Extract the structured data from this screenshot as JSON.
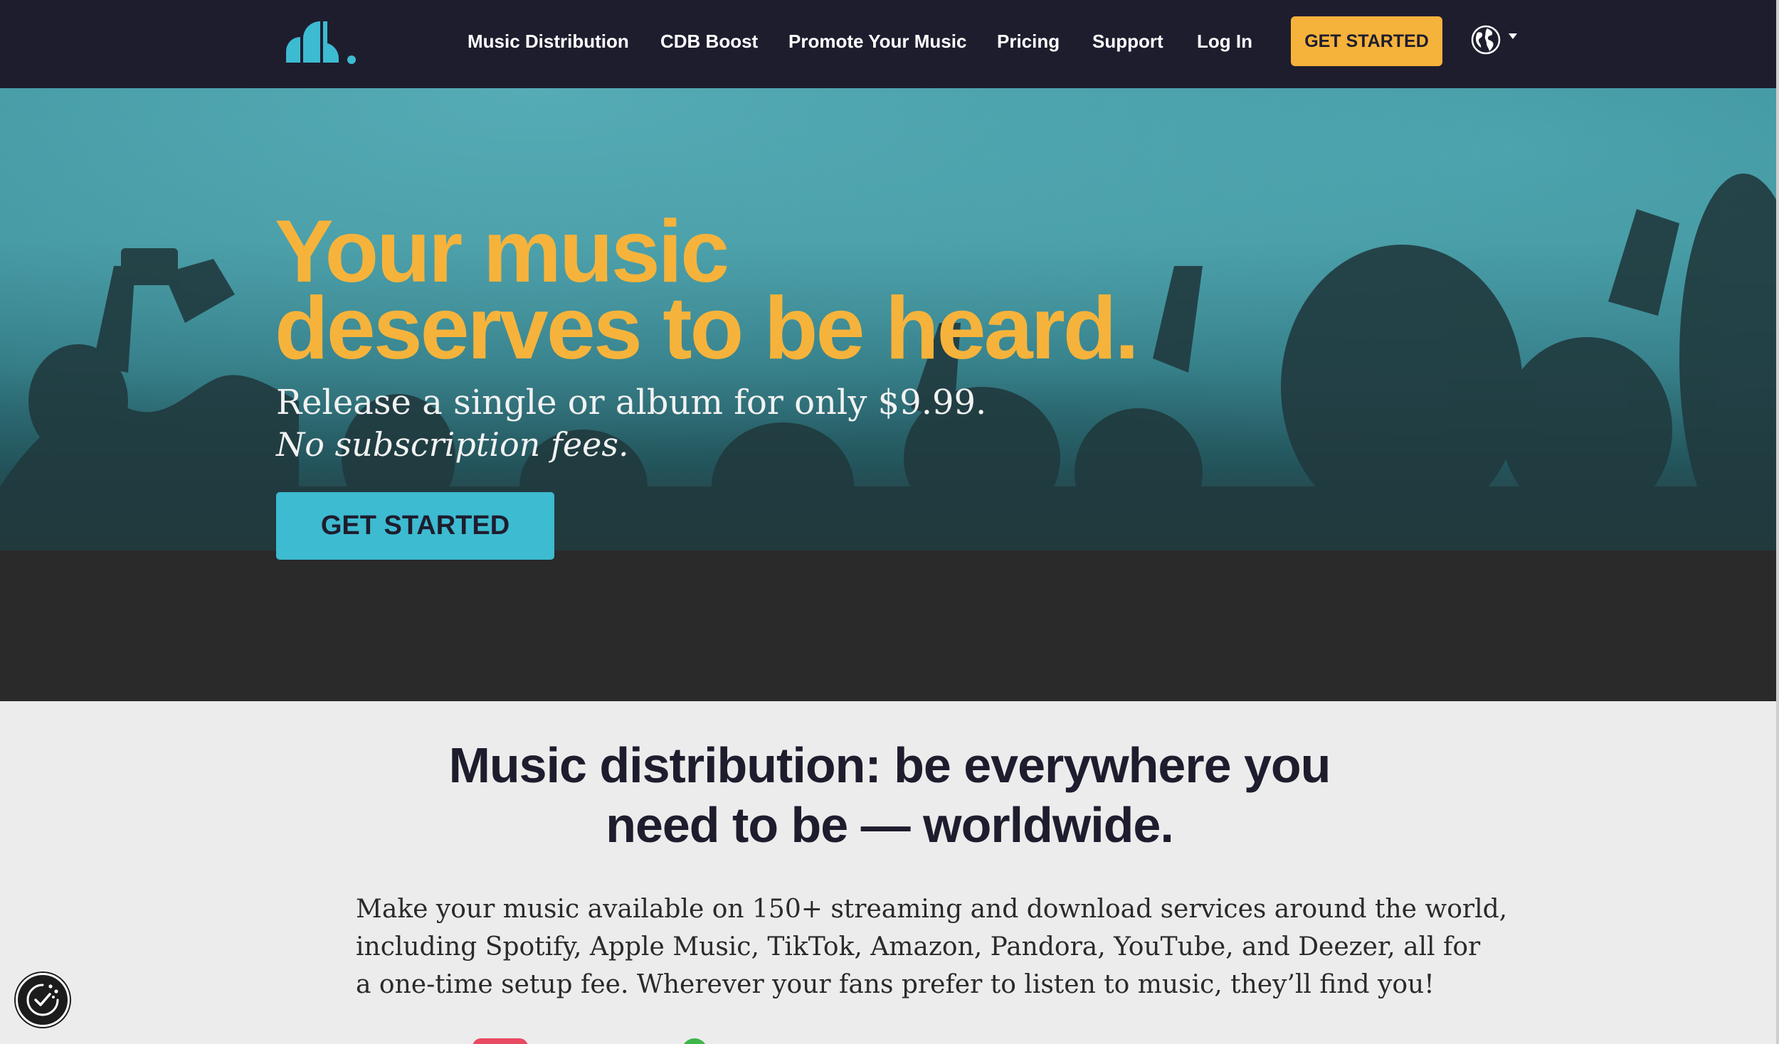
{
  "header": {
    "logo_icon": "cd-baby-logo",
    "nav": [
      {
        "label": "Music Distribution"
      },
      {
        "label": "CDB Boost"
      },
      {
        "label": "Promote Your Music"
      },
      {
        "label": "Pricing"
      },
      {
        "label": "Support"
      },
      {
        "label": "Log In"
      }
    ],
    "cta_label": "GET STARTED",
    "language_icon": "globe-icon"
  },
  "hero": {
    "title_line1": "Your music",
    "title_line2": "deserves to be heard.",
    "subtitle": "Release a single or album for only $9.99.",
    "subtitle_italic": "No subscription fees.",
    "cta_label": "GET STARTED"
  },
  "section": {
    "title_line1": "Music distribution: be everywhere you",
    "title_line2": "need to be — worldwide.",
    "body_line1": "Make your music available on 150+ streaming and download services around the world,",
    "body_line2": "including Spotify, Apple Music, TikTok, Amazon, Pandora, YouTube, and Deezer, all for",
    "body_line3": "a one-time setup fee. Wherever your fans prefer to listen to music, they’ll find you!"
  },
  "consent": {
    "icon": "cookie-consent-icon"
  },
  "colors": {
    "header_bg": "#1e1d2e",
    "accent_yellow": "#f6b33b",
    "accent_teal": "#3dbbd1",
    "page_bg": "#ececec"
  }
}
